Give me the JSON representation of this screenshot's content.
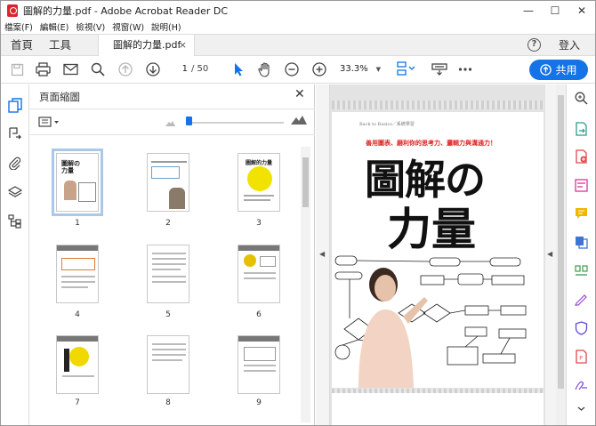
{
  "window": {
    "title": "圖解的力量.pdf - Adobe Acrobat Reader DC",
    "controls": [
      "—",
      "☐",
      "✕"
    ]
  },
  "menu": [
    "檔案(F)",
    "編輯(E)",
    "檢視(V)",
    "視窗(W)",
    "說明(H)"
  ],
  "tabs": {
    "home": "首頁",
    "tools": "工具",
    "document": "圖解的力量.pdf",
    "close": "×",
    "help": "?",
    "login": "登入"
  },
  "toolbar": {
    "page_current": "1",
    "page_total": "/ 50",
    "zoom": "33.3%",
    "share": "共用"
  },
  "panel": {
    "title": "頁面縮圖",
    "close": "✕",
    "thumbnails": [
      {
        "label": "1"
      },
      {
        "label": "2"
      },
      {
        "label": "3"
      },
      {
        "label": "4"
      },
      {
        "label": "5"
      },
      {
        "label": "6"
      },
      {
        "label": "7"
      },
      {
        "label": "8"
      },
      {
        "label": "9"
      }
    ]
  },
  "document": {
    "small_header": "Back to Basics／系統學習",
    "subtitle": "善用圖表、磨利你的思考力、邏輯力與溝通力！",
    "title_line1": "圖解の",
    "title_line2": "力量"
  },
  "colors": {
    "accent": "#1473e6",
    "acrobat_red": "#d9262c"
  }
}
